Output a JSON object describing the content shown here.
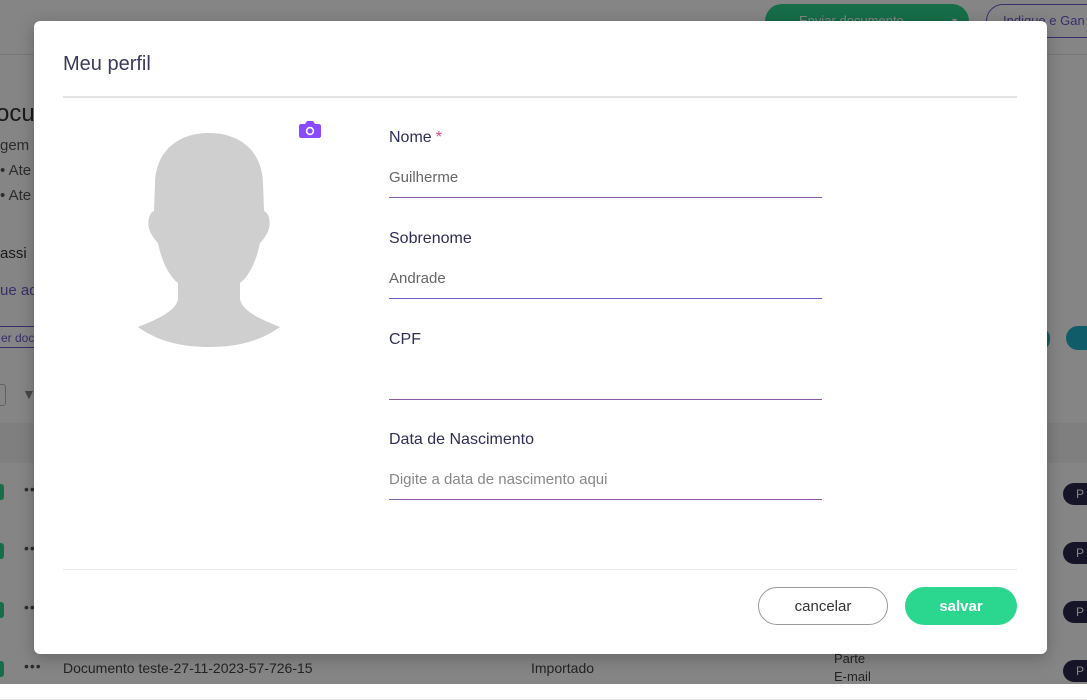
{
  "background": {
    "send_button": "Enviar documento",
    "refer_button": "Indique e Gan",
    "heading": "ocur",
    "subtext": "gem",
    "bullets": [
      "Ate",
      "Ate"
    ],
    "assin_text": "assi",
    "link_text": "ue aq",
    "pill_text": "er doc",
    "row_tag": "P",
    "last_row": {
      "name": "Documento teste-27-11-2023-57-726-15",
      "status": "Importado",
      "parte_label": "Parte",
      "email_label": "E-mail"
    }
  },
  "modal": {
    "title": "Meu perfil",
    "avatar_icon": "default-avatar-silhouette",
    "camera_icon": "camera-icon",
    "accent_color": "#8a4bff",
    "fields": [
      {
        "label": "Nome",
        "required_mark": "*",
        "value": "Guilherme",
        "placeholder": ""
      },
      {
        "label": "Sobrenome",
        "value": "Andrade",
        "placeholder": ""
      },
      {
        "label": "CPF",
        "value": "",
        "placeholder": ""
      },
      {
        "label": "Data de Nascimento",
        "value": "",
        "placeholder": "Digite a data de nascimento aqui"
      }
    ],
    "cancel_label": "cancelar",
    "save_label": "salvar",
    "save_color": "#2bd68f"
  }
}
